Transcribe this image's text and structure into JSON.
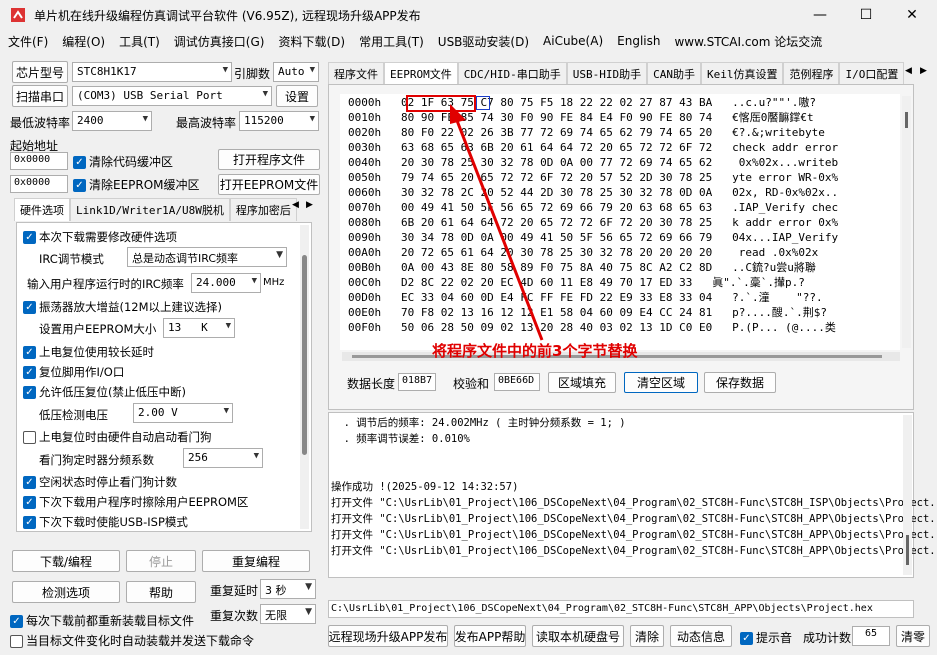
{
  "window": {
    "title": "单片机在线升级编程仿真调试平台软件 (V6.95Z), 远程现场升级APP发布",
    "minimize": "—",
    "maximize": "☐",
    "close": "✕"
  },
  "menu": [
    "文件(F)",
    "编程(O)",
    "工具(T)",
    "调试仿真接口(G)",
    "资料下载(D)",
    "常用工具(T)",
    "USB驱动安装(D)",
    "AiCube(A)",
    "English",
    "www.STCAI.com 论坛交流"
  ],
  "left": {
    "chip_label": "芯片型号",
    "chip_value": "STC8H1K17",
    "pins_label": "引脚数",
    "pins_value": "Auto",
    "scan_btn": "扫描串口",
    "port_value": "(COM3) USB Serial Port",
    "settings_btn": "设置",
    "min_baud_label": "最低波特率",
    "min_baud_value": "2400",
    "max_baud_label": "最高波特率",
    "max_baud_value": "115200",
    "start_addr_label": "起始地址",
    "addr1": "0x0000",
    "clear_code": "清除代码缓冲区",
    "open_prog": "打开程序文件",
    "addr2": "0x0000",
    "clear_eeprom": "清除EEPROM缓冲区",
    "open_eeprom": "打开EEPROM文件",
    "tabs": [
      "硬件选项",
      "Link1D/Writer1A/U8W脱机",
      "程序加密后"
    ],
    "hw": {
      "opt1": "本次下载需要修改硬件选项",
      "irc_mode_label": "IRC调节模式",
      "irc_mode_value": "总是动态调节IRC频率",
      "irc_freq_label": "输入用户程序运行时的IRC频率",
      "irc_freq_value": "24.000",
      "irc_unit": "MHz",
      "opt2": "振荡器放大增益(12M以上建议选择)",
      "eeprom_size_label": "设置用户EEPROM大小",
      "eeprom_size_value": "13",
      "eeprom_size_unit": "K",
      "opt3": "上电复位使用较长延时",
      "opt4": "复位脚用作I/O口",
      "opt5": "允许低压复位(禁止低压中断)",
      "lvd_label": "低压检测电压",
      "lvd_value": "2.00 V",
      "opt6": "上电复位时由硬件自动启动看门狗",
      "wdt_label": "看门狗定时器分频系数",
      "wdt_value": "256",
      "opt7": "空闲状态时停止看门狗计数",
      "opt8": "下次下载用户程序时擦除用户EEPROM区",
      "opt9": "下次下载时使能USB-ISP模式"
    },
    "download_btn": "下载/编程",
    "stop_btn": "停止",
    "reprog_btn": "重复编程",
    "check_btn": "检测选项",
    "help_btn": "帮助",
    "delay_label": "重复延时",
    "delay_value": "3 秒",
    "count_label": "重复次数",
    "count_value": "无限",
    "reload_opt": "每次下载前都重新装载目标文件",
    "auto_opt": "当目标文件变化时自动装载并发送下载命令"
  },
  "right": {
    "tabs": [
      "程序文件",
      "EEPROM文件",
      "CDC/HID-串口助手",
      "USB-HID助手",
      "CAN助手",
      "Keil仿真设置",
      "范例程序",
      "I/O口配置"
    ],
    "hex_rows": [
      {
        "addr": "0000h",
        "bytes": " 02 1F 63 75 C7 80 75 F5 18 22 22 02 27 87 43 BA",
        "ascii": "..c.u?\"\"'.嗷?"
      },
      {
        "addr": "0010h",
        "bytes": " 80 90 FE 85 74 30 F0 90 FE 84 E4 F0 90 FE 80 74",
        "ascii": "€愘厒0饜䩋鐣€t"
      },
      {
        "addr": "0020h",
        "bytes": " 80 F0 22 02 26 3B 77 72 69 74 65 62 79 74 65 20",
        "ascii": "€?.&;writebyte "
      },
      {
        "addr": "0030h",
        "bytes": " 63 68 65 63 6B 20 61 64 64 72 20 65 72 72 6F 72",
        "ascii": "check addr error"
      },
      {
        "addr": "0040h",
        "bytes": " 20 30 78 25 30 32 78 0D 0A 00 77 72 69 74 65 62",
        "ascii": " 0x%02x...writeb"
      },
      {
        "addr": "0050h",
        "bytes": " 79 74 65 20 65 72 72 6F 72 20 57 52 2D 30 78 25",
        "ascii": "yte error WR-0x%"
      },
      {
        "addr": "0060h",
        "bytes": " 30 32 78 2C 20 52 44 2D 30 78 25 30 32 78 0D 0A",
        "ascii": "02x, RD-0x%02x.."
      },
      {
        "addr": "0070h",
        "bytes": " 00 49 41 50 5F 56 65 72 69 66 79 20 63 68 65 63",
        "ascii": ".IAP_Verify chec"
      },
      {
        "addr": "0080h",
        "bytes": " 6B 20 61 64 64 72 20 65 72 72 6F 72 20 30 78 25",
        "ascii": "k addr error 0x%"
      },
      {
        "addr": "0090h",
        "bytes": " 30 34 78 0D 0A 00 49 41 50 5F 56 65 72 69 66 79",
        "ascii": "04x...IAP_Verify"
      },
      {
        "addr": "00A0h",
        "bytes": " 20 72 65 61 64 20 30 78 25 30 32 78 20 20 20 20",
        "ascii": " read .0x%02x   "
      },
      {
        "addr": "00B0h",
        "bytes": " 0A 00 43 8E 80 58 89 F0 75 8A 40 75 8C A2 C2 8D",
        "ascii": "..C鋶?u尝u將聯"
      },
      {
        "addr": "00C0h",
        "bytes": " D2 8C 22 02 20 EC 4D 60 11 E8 49 70 17 ED 33",
        "ascii": "眞\".`.稾`.攆p.?"
      },
      {
        "addr": "00D0h",
        "bytes": " EC 33 04 60 0D E4 FC FF FE FD 22 E9 33 E8 33 04",
        "ascii": "?.`.潼    \"??."
      },
      {
        "addr": "00E0h",
        "bytes": " 70 F8 02 13 16 12 12 E1 58 04 60 09 E4 CC 24 81",
        "ascii": "p?....醙.`.荆$?"
      },
      {
        "addr": "00F0h",
        "bytes": " 50 06 28 50 09 02 13 20 28 40 03 02 13 1D C0 E0",
        "ascii": "P.(P... (@....类"
      }
    ],
    "annotation": "将程序文件中的前3个字节替换",
    "annotation_color": "#e00000",
    "data_len_label": "数据长度",
    "data_len_value": "018B7",
    "checksum_label": "校验和",
    "checksum_value": "0BE66D",
    "fill_btn": "区域填充",
    "clear_btn": "清空区域",
    "save_btn": "保存数据",
    "log_lines": [
      "  . 调节后的频率: 24.002MHz ( 主时钟分频系数 = 1; )",
      "  . 频率调节误差: 0.010%",
      "",
      "",
      "操作成功 !(2025-09-12 14:32:57)",
      "打开文件 \"C:\\UsrLib\\01_Project\\106_DSCopeNext\\04_Program\\02_STC8H-Func\\STC8H_ISP\\Objects\\Project.]",
      "打开文件 \"C:\\UsrLib\\01_Project\\106_DSCopeNext\\04_Program\\02_STC8H-Func\\STC8H_APP\\Objects\\Project.]",
      "打开文件 \"C:\\UsrLib\\01_Project\\106_DSCopeNext\\04_Program\\02_STC8H-Func\\STC8H_APP\\Objects\\Project.]",
      "打开文件 \"C:\\UsrLib\\01_Project\\106_DSCopeNext\\04_Program\\02_STC8H-Func\\STC8H_APP\\Objects\\Project.]"
    ],
    "path": "C:\\UsrLib\\01_Project\\106_DSCopeNext\\04_Program\\02_STC8H-Func\\STC8H_APP\\Objects\\Project.hex",
    "bottom_btns": [
      "远程现场升级APP发布",
      "发布APP帮助",
      "读取本机硬盘号",
      "清除",
      "动态信息"
    ],
    "beep_label": "提示音",
    "success_label": "成功计数",
    "success_value": "65",
    "zero_btn": "清零"
  }
}
